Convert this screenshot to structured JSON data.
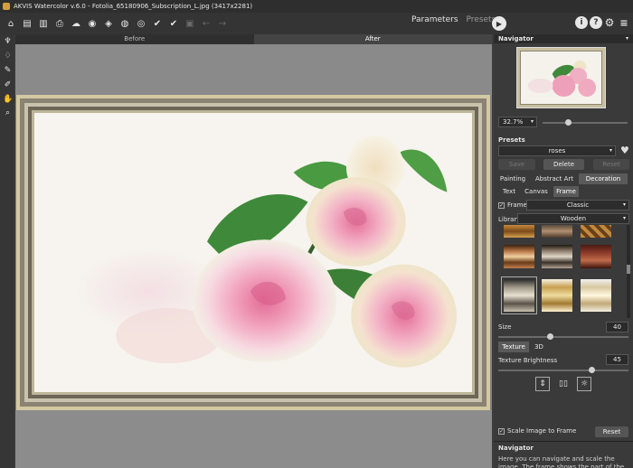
{
  "window": {
    "title": "AKVIS Watercolor v.6.0 - Fotolia_65180906_Subscription_L.jpg (3417x2281)"
  },
  "toolbar": {
    "tabs": [
      {
        "label": "Parameters"
      },
      {
        "label": "Presets"
      }
    ],
    "icons": [
      "open-icon",
      "save-icon",
      "save-as-icon",
      "print-icon",
      "share-icon",
      "batch-icon",
      "edit-icon",
      "undo-icon",
      "redo-icon",
      "run-icon",
      "info-icon",
      "help-icon",
      "settings-icon",
      "menu-icon"
    ]
  },
  "view": {
    "before_label": "Before",
    "after_label": "After"
  },
  "navigator": {
    "title": "Navigator",
    "zoom": "32.7%"
  },
  "presets": {
    "title": "Presets",
    "selected": "roses",
    "save_label": "Save",
    "delete_label": "Delete",
    "reset_label": "Reset"
  },
  "main_tabs": [
    {
      "label": "Painting"
    },
    {
      "label": "Abstract Art"
    },
    {
      "label": "Decoration"
    }
  ],
  "sub_tabs": [
    {
      "label": "Text"
    },
    {
      "label": "Canvas"
    },
    {
      "label": "Frame"
    }
  ],
  "frame": {
    "checkbox_label": "Frame",
    "checked_mark": "✓",
    "type": "Classic",
    "library_label": "Library",
    "library": "Wooden",
    "size_label": "Size",
    "size_value": "40",
    "size_fraction": 0.4,
    "texture_tab": "Texture",
    "threed_tab": "3D",
    "brightness_label": "Texture Brightness",
    "brightness_value": "45",
    "brightness_fraction": 0.72,
    "scale_label": "Scale Image to Frame",
    "scale_checked_mark": "✓",
    "reset_label": "Reset"
  },
  "help": {
    "title": "Navigator",
    "text": "Here you can navigate and scale the image. The frame shows the part of the image that is"
  },
  "colors": {
    "accent": "#5a5a5a",
    "panel": "#3a3a3a",
    "frame_gold": "#d2c8a2",
    "rose_pink": "#f0a9c0",
    "leaf_green": "#3f8a3a"
  }
}
